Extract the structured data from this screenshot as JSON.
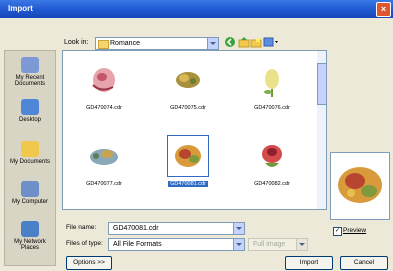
{
  "window": {
    "title": "Import"
  },
  "lookin": {
    "label": "Look in:",
    "value": "Romance"
  },
  "places": [
    {
      "label": "My Recent Documents",
      "icon": "recent-documents-icon",
      "color": "#7e9ad6"
    },
    {
      "label": "Desktop",
      "icon": "desktop-icon",
      "color": "#4f86d6"
    },
    {
      "label": "My Documents",
      "icon": "my-documents-icon",
      "color": "#f0c84c"
    },
    {
      "label": "My Computer",
      "icon": "my-computer-icon",
      "color": "#6f8fc9"
    },
    {
      "label": "My Network Places",
      "icon": "network-places-icon",
      "color": "#4b80c9"
    }
  ],
  "files": [
    {
      "name": "GD470074.cdr",
      "selected": false
    },
    {
      "name": "GD470075.cdr",
      "selected": false
    },
    {
      "name": "GD470076.cdr",
      "selected": false
    },
    {
      "name": "GD470077.cdr",
      "selected": false
    },
    {
      "name": "GD470081.cdr",
      "selected": true
    },
    {
      "name": "GD470082.cdr",
      "selected": false
    }
  ],
  "filename": {
    "label": "File name:",
    "value": "GD470081.cdr"
  },
  "filetype": {
    "label": "Files of type:",
    "value": "All File Formats"
  },
  "fullimage": {
    "value": "Full image"
  },
  "buttons": {
    "options": "Options >>",
    "import": "Import",
    "cancel": "Cancel"
  },
  "preview": {
    "label": "Preview",
    "checked": true
  },
  "colors": {
    "titlebar": "#1d55cf",
    "selection": "#316ac5"
  }
}
